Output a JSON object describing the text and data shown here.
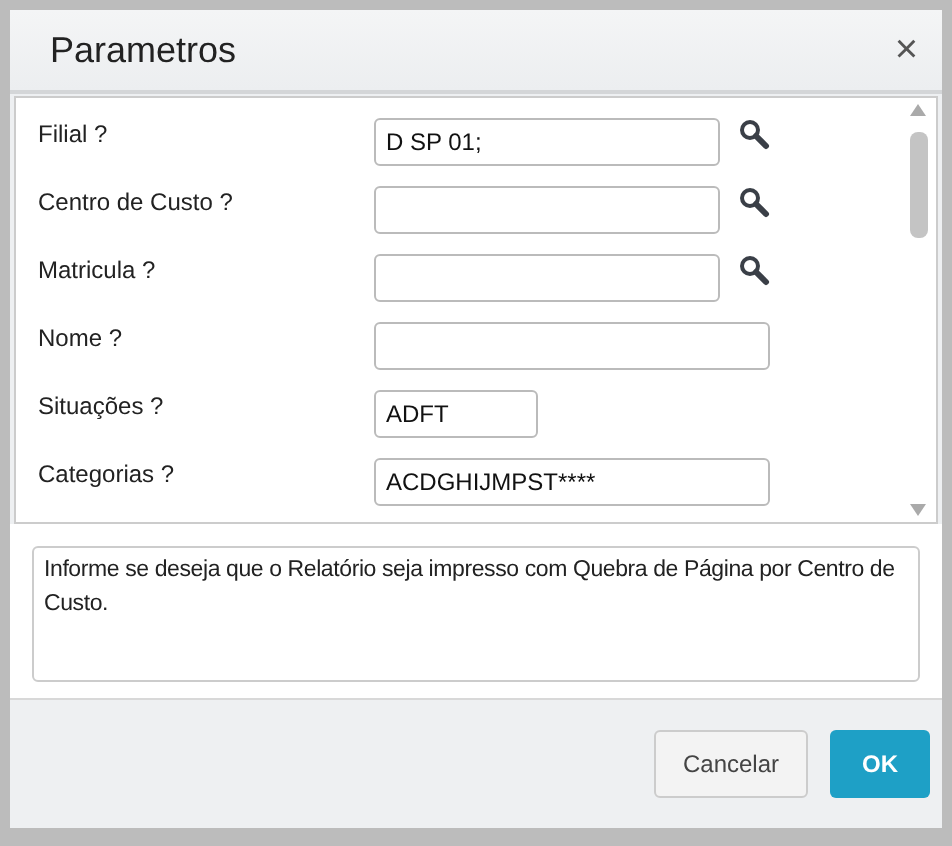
{
  "dialog": {
    "title": "Parametros",
    "close": "×"
  },
  "fields": [
    {
      "label": "Filial ?",
      "kind": "lookup",
      "value": "D SP 01;"
    },
    {
      "label": "Centro de Custo ?",
      "kind": "lookup"
    },
    {
      "label": "Matricula ?",
      "kind": "lookup"
    },
    {
      "label": "Nome ?",
      "kind": "wide"
    },
    {
      "label": "Situações ?",
      "kind": "short",
      "value": "ADFT"
    },
    {
      "label": "Categorias ?",
      "kind": "wide",
      "value": "ACDGHIJMPST****"
    }
  ],
  "help": "Informe se deseja que o Relatório seja impresso com Quebra de Página por Centro de Custo.",
  "buttons": [
    {
      "label": "Cancelar",
      "kind": "secondary"
    },
    {
      "label": "OK",
      "kind": "primary"
    }
  ]
}
